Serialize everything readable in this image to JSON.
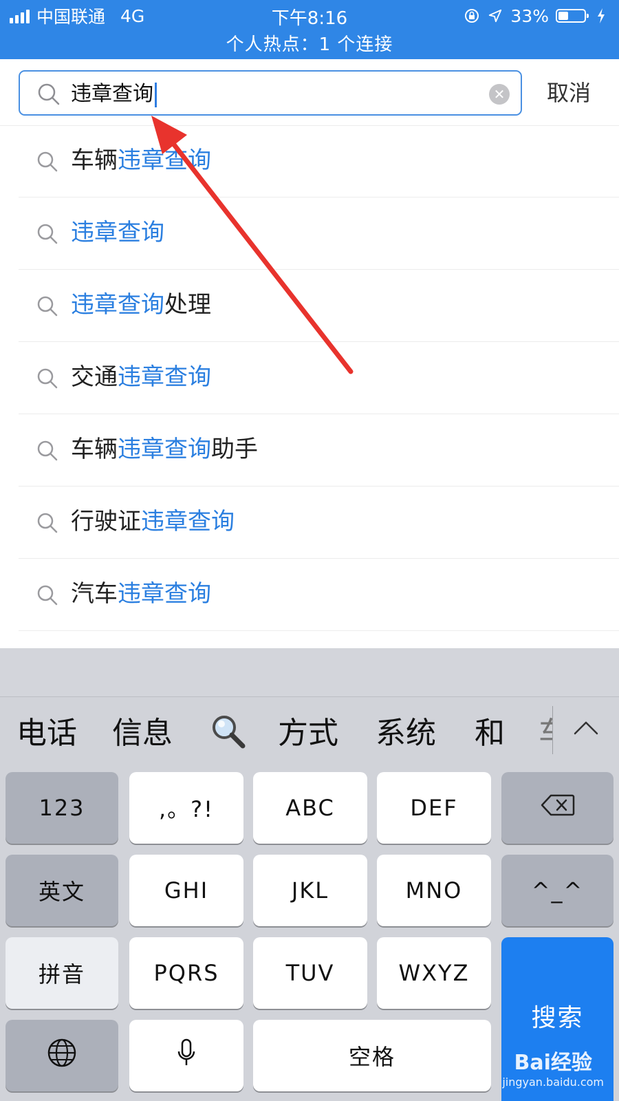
{
  "status_bar": {
    "carrier": "中国联通",
    "network": "4G",
    "time": "下午8:16",
    "battery": "33%",
    "hotspot": "个人热点：1 个连接",
    "icons": [
      "signal-icon",
      "rotation-lock-icon",
      "location-arrow-icon",
      "battery-icon",
      "charging-icon"
    ]
  },
  "search": {
    "query": "违章查询",
    "cancel": "取消",
    "icon": "search-icon",
    "clear_icon": "clear-icon"
  },
  "suggestions": [
    {
      "pre": "车辆",
      "hl": "违章查询",
      "post": ""
    },
    {
      "pre": "",
      "hl": "违章查询",
      "post": ""
    },
    {
      "pre": "",
      "hl": "违章查询",
      "post": "处理"
    },
    {
      "pre": "交通",
      "hl": "违章查询",
      "post": ""
    },
    {
      "pre": "车辆",
      "hl": "违章查询",
      "post": "助手"
    },
    {
      "pre": "行驶证",
      "hl": "违章查询",
      "post": ""
    },
    {
      "pre": "汽车",
      "hl": "违章查询",
      "post": ""
    }
  ],
  "keyboard": {
    "candidates": [
      "电话",
      "信息",
      "方式",
      "系统",
      "和",
      "车"
    ],
    "keys": {
      "num": "123",
      "punct": ",。?!",
      "abc": "ABC",
      "def": "DEF",
      "english": "英文",
      "ghi": "GHI",
      "jkl": "JKL",
      "mno": "MNO",
      "emoticon": "^_^",
      "pinyin": "拼音",
      "pqrs": "PQRS",
      "tuv": "TUV",
      "wxyz": "WXYZ",
      "search": "搜索",
      "space": "空格"
    },
    "icons": [
      "delete-icon",
      "globe-icon",
      "microphone-icon",
      "magnifier-emoji-icon",
      "chevron-up-icon"
    ]
  },
  "watermark": {
    "brand": "Bai经验",
    "url": "jingyan.baidu.com"
  },
  "colors": {
    "status_bar": "#2f86e6",
    "highlight": "#2b7fe0",
    "search_key": "#1d7ff0",
    "annotation_arrow": "#e8332d",
    "keyboard_bg": "#d1d3d9"
  }
}
